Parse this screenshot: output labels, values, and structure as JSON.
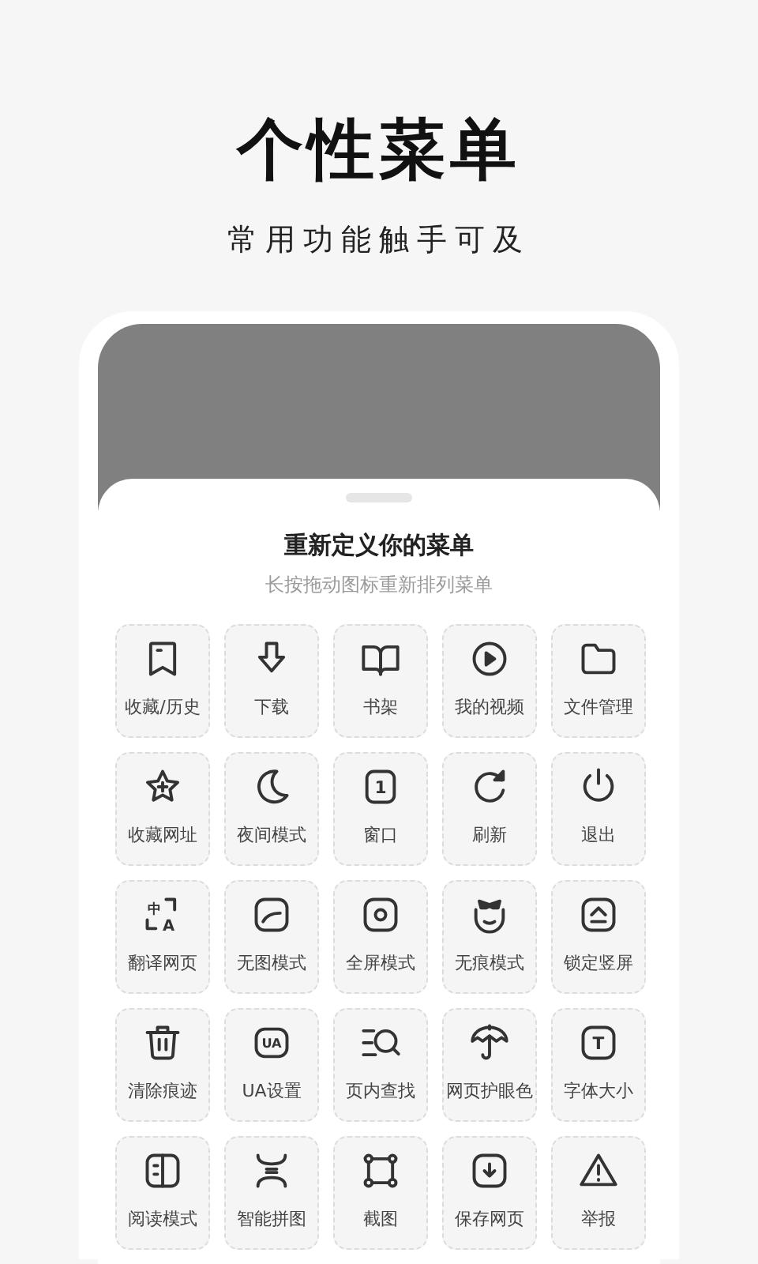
{
  "headline": {
    "title": "个性菜单",
    "subtitle": "常用功能触手可及"
  },
  "sheet": {
    "title": "重新定义你的菜单",
    "hint": "长按拖动图标重新排列菜单"
  },
  "menu_items": [
    {
      "label": "收藏/历史"
    },
    {
      "label": "下载"
    },
    {
      "label": "书架"
    },
    {
      "label": "我的视频"
    },
    {
      "label": "文件管理"
    },
    {
      "label": "收藏网址"
    },
    {
      "label": "夜间模式"
    },
    {
      "label": "窗口",
      "icon_text": "1"
    },
    {
      "label": "刷新"
    },
    {
      "label": "退出"
    },
    {
      "label": "翻译网页",
      "icon_text": "中A"
    },
    {
      "label": "无图模式"
    },
    {
      "label": "全屏模式"
    },
    {
      "label": "无痕模式"
    },
    {
      "label": "锁定竖屏"
    },
    {
      "label": "清除痕迹"
    },
    {
      "label": "UA设置",
      "icon_text": "UA"
    },
    {
      "label": "页内查找"
    },
    {
      "label": "网页护眼色"
    },
    {
      "label": "字体大小",
      "icon_text": "T"
    },
    {
      "label": "阅读模式"
    },
    {
      "label": "智能拼图"
    },
    {
      "label": "截图"
    },
    {
      "label": "保存网页"
    },
    {
      "label": "举报"
    }
  ]
}
